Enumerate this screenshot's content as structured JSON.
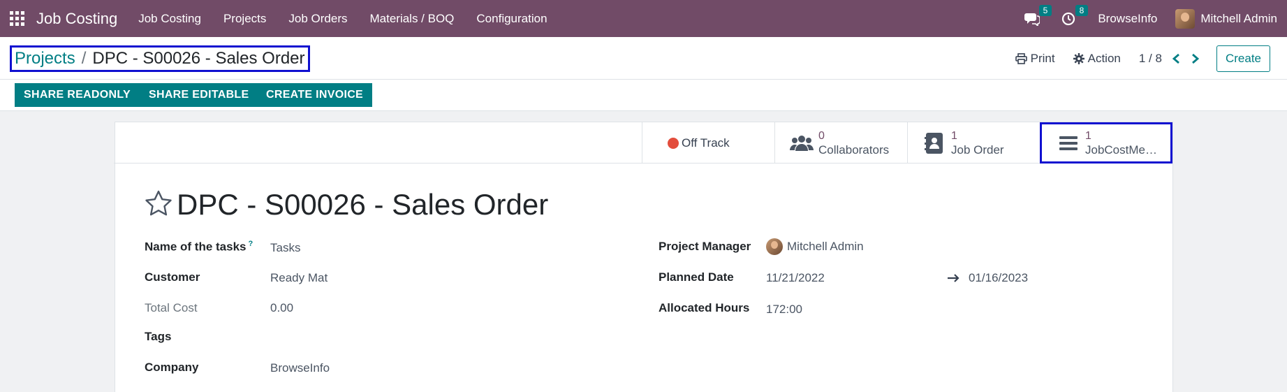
{
  "navbar": {
    "app_name": "Job Costing",
    "menu": [
      "Job Costing",
      "Projects",
      "Job Orders",
      "Materials / BOQ",
      "Configuration"
    ],
    "messages_count": "5",
    "activities_count": "8",
    "company": "BrowseInfo",
    "user": "Mitchell Admin"
  },
  "control_panel": {
    "breadcrumb_parent": "Projects",
    "breadcrumb_separator": "/",
    "breadcrumb_current": "DPC - S00026 - Sales Order",
    "print_label": "Print",
    "action_label": "Action",
    "pager": "1 / 8",
    "create_label": "Create"
  },
  "statusbar": {
    "share_readonly": "SHARE READONLY",
    "share_editable": "SHARE EDITABLE",
    "create_invoice": "CREATE INVOICE"
  },
  "smart_buttons": {
    "status_label": "Off Track",
    "status_color": "#e34d3c",
    "collaborators_count": "0",
    "collaborators_label": "Collaborators",
    "job_order_count": "1",
    "job_order_label": "Job Order",
    "jobcost_count": "1",
    "jobcost_label": "JobCostMe…"
  },
  "form": {
    "title": "DPC - S00026 - Sales Order",
    "help_marker": "?",
    "left": {
      "tasks_label": "Name of the tasks",
      "tasks_value": "Tasks",
      "customer_label": "Customer",
      "customer_value": "Ready Mat",
      "total_cost_label": "Total Cost",
      "total_cost_value": "0.00",
      "tags_label": "Tags",
      "company_label": "Company",
      "company_value": "BrowseInfo"
    },
    "right": {
      "pm_label": "Project Manager",
      "pm_value": "Mitchell Admin",
      "planned_label": "Planned Date",
      "planned_start": "11/21/2022",
      "planned_end": "01/16/2023",
      "hours_label": "Allocated Hours",
      "hours_value": "172:00"
    }
  },
  "colors": {
    "navbar": "#714b67",
    "primary": "#017e84",
    "highlight_box": "#1010d0"
  }
}
